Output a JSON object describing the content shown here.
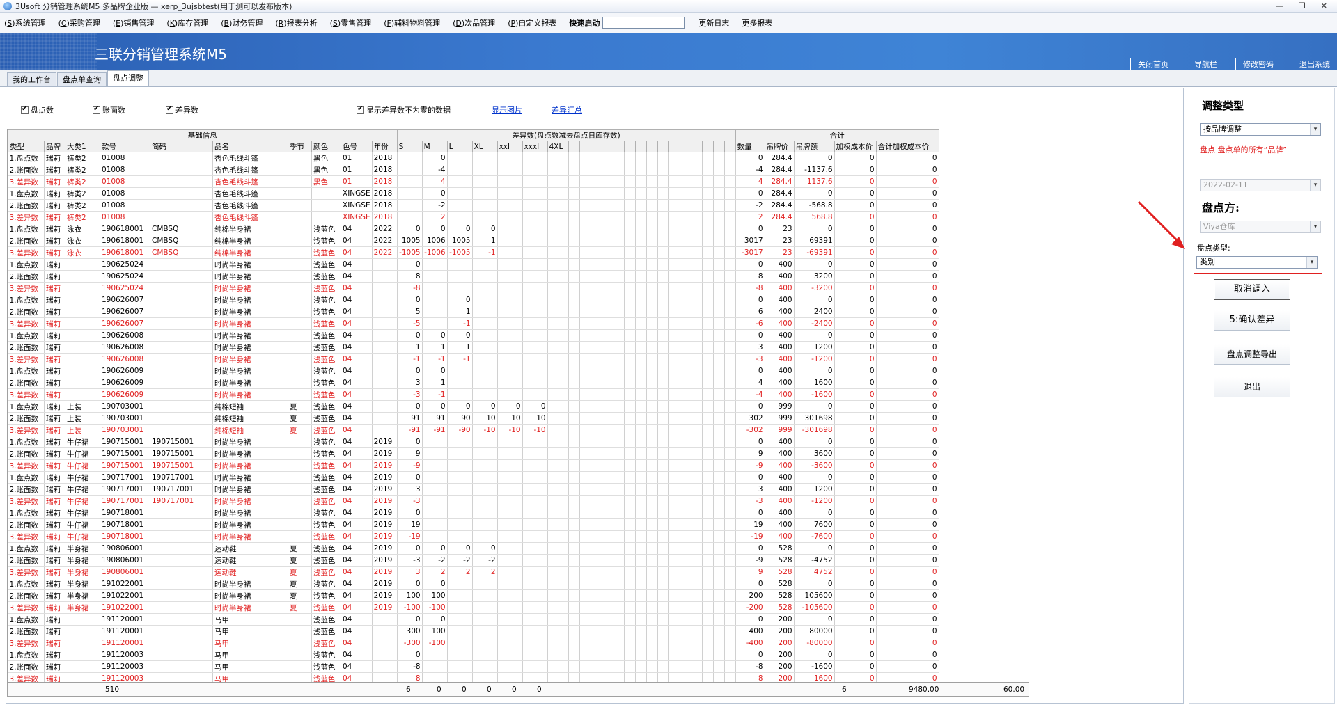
{
  "window": {
    "title": "3Usoft 分销管理系统M5 多品牌企业版 — xerp_3ujsbtest(用于测可以发布版本)"
  },
  "menu": [
    {
      "key": "S",
      "label": "系统管理"
    },
    {
      "key": "C",
      "label": "采购管理"
    },
    {
      "key": "E",
      "label": "销售管理"
    },
    {
      "key": "K",
      "label": "库存管理"
    },
    {
      "key": "B",
      "label": "财务管理"
    },
    {
      "key": "R",
      "label": "报表分析"
    },
    {
      "key": "S",
      "label": "零售管理"
    },
    {
      "key": "F",
      "label": "辅料物料管理"
    },
    {
      "key": "D",
      "label": "次品管理"
    },
    {
      "key": "P",
      "label": "自定义报表"
    }
  ],
  "quickstart_label": "快速启动",
  "menu_extra": [
    "更新日志",
    "更多报表"
  ],
  "banner": {
    "title": "三联分销管理系统M5",
    "links": [
      "关闭首页",
      "导航栏",
      "修改密码",
      "退出系统"
    ]
  },
  "tabs": [
    "我的工作台",
    "盘点单查询",
    "盘点调整"
  ],
  "options": {
    "c1": "盘点数",
    "c2": "账面数",
    "c3": "差异数",
    "c4": "显示差异数不为零的数据",
    "link1": "显示图片",
    "link2": "差异汇总"
  },
  "groups": {
    "basic": "基础信息",
    "diff": "差异数(盘点数减去盘点日库存数)",
    "total": "合计"
  },
  "columns": [
    "类型",
    "品牌",
    "大类1",
    "款号",
    "简码",
    "品名",
    "季节",
    "颜色",
    "色号",
    "年份",
    "S",
    "M",
    "L",
    "XL",
    "xxl",
    "xxxl",
    "4XL",
    "数量",
    "吊牌价",
    "吊牌额",
    "加权成本价",
    "合计加权成本价"
  ],
  "rows": [
    [
      "1.盘点数",
      "瑞莉",
      "裤类2",
      "01008",
      "",
      "杏色毛线斗篷",
      "",
      "黑色",
      "01",
      "2018",
      "",
      "0",
      "",
      "",
      "",
      "",
      "",
      "0",
      "284.4",
      "0",
      "0",
      "0"
    ],
    [
      "2.账面数",
      "瑞莉",
      "裤类2",
      "01008",
      "",
      "杏色毛线斗篷",
      "",
      "黑色",
      "01",
      "2018",
      "",
      "-4",
      "",
      "",
      "",
      "",
      "",
      "-4",
      "284.4",
      "-1137.6",
      "0",
      "0"
    ],
    [
      "3.差异数",
      "瑞莉",
      "裤类2",
      "01008",
      "",
      "杏色毛线斗篷",
      "",
      "黑色",
      "01",
      "2018",
      "",
      "4",
      "",
      "",
      "",
      "",
      "",
      "4",
      "284.4",
      "1137.6",
      "0",
      "0"
    ],
    [
      "1.盘点数",
      "瑞莉",
      "裤类2",
      "01008",
      "",
      "杏色毛线斗篷",
      "",
      "",
      "XINGSE",
      "2018",
      "",
      "0",
      "",
      "",
      "",
      "",
      "",
      "0",
      "284.4",
      "0",
      "0",
      "0"
    ],
    [
      "2.账面数",
      "瑞莉",
      "裤类2",
      "01008",
      "",
      "杏色毛线斗篷",
      "",
      "",
      "XINGSE",
      "2018",
      "",
      "-2",
      "",
      "",
      "",
      "",
      "",
      "-2",
      "284.4",
      "-568.8",
      "0",
      "0"
    ],
    [
      "3.差异数",
      "瑞莉",
      "裤类2",
      "01008",
      "",
      "杏色毛线斗篷",
      "",
      "",
      "XINGSE",
      "2018",
      "",
      "2",
      "",
      "",
      "",
      "",
      "",
      "2",
      "284.4",
      "568.8",
      "0",
      "0"
    ],
    [
      "1.盘点数",
      "瑞莉",
      "泳衣",
      "190618001",
      "CMBSQ",
      "纯棉半身裙",
      "",
      "浅蓝色",
      "04",
      "2022",
      "0",
      "0",
      "0",
      "0",
      "",
      "",
      "",
      "0",
      "23",
      "0",
      "0",
      "0"
    ],
    [
      "2.账面数",
      "瑞莉",
      "泳衣",
      "190618001",
      "CMBSQ",
      "纯棉半身裙",
      "",
      "浅蓝色",
      "04",
      "2022",
      "1005",
      "1006",
      "1005",
      "1",
      "",
      "",
      "",
      "3017",
      "23",
      "69391",
      "0",
      "0"
    ],
    [
      "3.差异数",
      "瑞莉",
      "泳衣",
      "190618001",
      "CMBSQ",
      "纯棉半身裙",
      "",
      "浅蓝色",
      "04",
      "2022",
      "-1005",
      "-1006",
      "-1005",
      "-1",
      "",
      "",
      "",
      "-3017",
      "23",
      "-69391",
      "0",
      "0"
    ],
    [
      "1.盘点数",
      "瑞莉",
      "",
      "190625024",
      "",
      "时尚半身裙",
      "",
      "浅蓝色",
      "04",
      "",
      "0",
      "",
      "",
      "",
      "",
      "",
      "",
      "0",
      "400",
      "0",
      "0",
      "0"
    ],
    [
      "2.账面数",
      "瑞莉",
      "",
      "190625024",
      "",
      "时尚半身裙",
      "",
      "浅蓝色",
      "04",
      "",
      "8",
      "",
      "",
      "",
      "",
      "",
      "",
      "8",
      "400",
      "3200",
      "0",
      "0"
    ],
    [
      "3.差异数",
      "瑞莉",
      "",
      "190625024",
      "",
      "时尚半身裙",
      "",
      "浅蓝色",
      "04",
      "",
      "-8",
      "",
      "",
      "",
      "",
      "",
      "",
      "-8",
      "400",
      "-3200",
      "0",
      "0"
    ],
    [
      "1.盘点数",
      "瑞莉",
      "",
      "190626007",
      "",
      "时尚半身裙",
      "",
      "浅蓝色",
      "04",
      "",
      "0",
      "",
      "0",
      "",
      "",
      "",
      "",
      "0",
      "400",
      "0",
      "0",
      "0"
    ],
    [
      "2.账面数",
      "瑞莉",
      "",
      "190626007",
      "",
      "时尚半身裙",
      "",
      "浅蓝色",
      "04",
      "",
      "5",
      "",
      "1",
      "",
      "",
      "",
      "",
      "6",
      "400",
      "2400",
      "0",
      "0"
    ],
    [
      "3.差异数",
      "瑞莉",
      "",
      "190626007",
      "",
      "时尚半身裙",
      "",
      "浅蓝色",
      "04",
      "",
      "-5",
      "",
      "-1",
      "",
      "",
      "",
      "",
      "-6",
      "400",
      "-2400",
      "0",
      "0"
    ],
    [
      "1.盘点数",
      "瑞莉",
      "",
      "190626008",
      "",
      "时尚半身裙",
      "",
      "浅蓝色",
      "04",
      "",
      "0",
      "0",
      "0",
      "",
      "",
      "",
      "",
      "0",
      "400",
      "0",
      "0",
      "0"
    ],
    [
      "2.账面数",
      "瑞莉",
      "",
      "190626008",
      "",
      "时尚半身裙",
      "",
      "浅蓝色",
      "04",
      "",
      "1",
      "1",
      "1",
      "",
      "",
      "",
      "",
      "3",
      "400",
      "1200",
      "0",
      "0"
    ],
    [
      "3.差异数",
      "瑞莉",
      "",
      "190626008",
      "",
      "时尚半身裙",
      "",
      "浅蓝色",
      "04",
      "",
      "-1",
      "-1",
      "-1",
      "",
      "",
      "",
      "",
      "-3",
      "400",
      "-1200",
      "0",
      "0"
    ],
    [
      "1.盘点数",
      "瑞莉",
      "",
      "190626009",
      "",
      "时尚半身裙",
      "",
      "浅蓝色",
      "04",
      "",
      "0",
      "0",
      "",
      "",
      "",
      "",
      "",
      "0",
      "400",
      "0",
      "0",
      "0"
    ],
    [
      "2.账面数",
      "瑞莉",
      "",
      "190626009",
      "",
      "时尚半身裙",
      "",
      "浅蓝色",
      "04",
      "",
      "3",
      "1",
      "",
      "",
      "",
      "",
      "",
      "4",
      "400",
      "1600",
      "0",
      "0"
    ],
    [
      "3.差异数",
      "瑞莉",
      "",
      "190626009",
      "",
      "时尚半身裙",
      "",
      "浅蓝色",
      "04",
      "",
      "-3",
      "-1",
      "",
      "",
      "",
      "",
      "",
      "-4",
      "400",
      "-1600",
      "0",
      "0"
    ],
    [
      "1.盘点数",
      "瑞莉",
      "上装",
      "190703001",
      "",
      "纯棉短袖",
      "夏",
      "浅蓝色",
      "04",
      "",
      "0",
      "0",
      "0",
      "0",
      "0",
      "0",
      "",
      "0",
      "999",
      "0",
      "0",
      "0"
    ],
    [
      "2.账面数",
      "瑞莉",
      "上装",
      "190703001",
      "",
      "纯棉短袖",
      "夏",
      "浅蓝色",
      "04",
      "",
      "91",
      "91",
      "90",
      "10",
      "10",
      "10",
      "",
      "302",
      "999",
      "301698",
      "0",
      "0"
    ],
    [
      "3.差异数",
      "瑞莉",
      "上装",
      "190703001",
      "",
      "纯棉短袖",
      "夏",
      "浅蓝色",
      "04",
      "",
      "-91",
      "-91",
      "-90",
      "-10",
      "-10",
      "-10",
      "",
      "-302",
      "999",
      "-301698",
      "0",
      "0"
    ],
    [
      "1.盘点数",
      "瑞莉",
      "牛仔裙",
      "190715001",
      "190715001",
      "时尚半身裙",
      "",
      "浅蓝色",
      "04",
      "2019",
      "0",
      "",
      "",
      "",
      "",
      "",
      "",
      "0",
      "400",
      "0",
      "0",
      "0"
    ],
    [
      "2.账面数",
      "瑞莉",
      "牛仔裙",
      "190715001",
      "190715001",
      "时尚半身裙",
      "",
      "浅蓝色",
      "04",
      "2019",
      "9",
      "",
      "",
      "",
      "",
      "",
      "",
      "9",
      "400",
      "3600",
      "0",
      "0"
    ],
    [
      "3.差异数",
      "瑞莉",
      "牛仔裙",
      "190715001",
      "190715001",
      "时尚半身裙",
      "",
      "浅蓝色",
      "04",
      "2019",
      "-9",
      "",
      "",
      "",
      "",
      "",
      "",
      "-9",
      "400",
      "-3600",
      "0",
      "0"
    ],
    [
      "1.盘点数",
      "瑞莉",
      "牛仔裙",
      "190717001",
      "190717001",
      "时尚半身裙",
      "",
      "浅蓝色",
      "04",
      "2019",
      "0",
      "",
      "",
      "",
      "",
      "",
      "",
      "0",
      "400",
      "0",
      "0",
      "0"
    ],
    [
      "2.账面数",
      "瑞莉",
      "牛仔裙",
      "190717001",
      "190717001",
      "时尚半身裙",
      "",
      "浅蓝色",
      "04",
      "2019",
      "3",
      "",
      "",
      "",
      "",
      "",
      "",
      "3",
      "400",
      "1200",
      "0",
      "0"
    ],
    [
      "3.差异数",
      "瑞莉",
      "牛仔裙",
      "190717001",
      "190717001",
      "时尚半身裙",
      "",
      "浅蓝色",
      "04",
      "2019",
      "-3",
      "",
      "",
      "",
      "",
      "",
      "",
      "-3",
      "400",
      "-1200",
      "0",
      "0"
    ],
    [
      "1.盘点数",
      "瑞莉",
      "牛仔裙",
      "190718001",
      "",
      "时尚半身裙",
      "",
      "浅蓝色",
      "04",
      "2019",
      "0",
      "",
      "",
      "",
      "",
      "",
      "",
      "0",
      "400",
      "0",
      "0",
      "0"
    ],
    [
      "2.账面数",
      "瑞莉",
      "牛仔裙",
      "190718001",
      "",
      "时尚半身裙",
      "",
      "浅蓝色",
      "04",
      "2019",
      "19",
      "",
      "",
      "",
      "",
      "",
      "",
      "19",
      "400",
      "7600",
      "0",
      "0"
    ],
    [
      "3.差异数",
      "瑞莉",
      "牛仔裙",
      "190718001",
      "",
      "时尚半身裙",
      "",
      "浅蓝色",
      "04",
      "2019",
      "-19",
      "",
      "",
      "",
      "",
      "",
      "",
      "-19",
      "400",
      "-7600",
      "0",
      "0"
    ],
    [
      "1.盘点数",
      "瑞莉",
      "半身裙",
      "190806001",
      "",
      "运动鞋",
      "夏",
      "浅蓝色",
      "04",
      "2019",
      "0",
      "0",
      "0",
      "0",
      "",
      "",
      "",
      "0",
      "528",
      "0",
      "0",
      "0"
    ],
    [
      "2.账面数",
      "瑞莉",
      "半身裙",
      "190806001",
      "",
      "运动鞋",
      "夏",
      "浅蓝色",
      "04",
      "2019",
      "-3",
      "-2",
      "-2",
      "-2",
      "",
      "",
      "",
      "-9",
      "528",
      "-4752",
      "0",
      "0"
    ],
    [
      "3.差异数",
      "瑞莉",
      "半身裙",
      "190806001",
      "",
      "运动鞋",
      "夏",
      "浅蓝色",
      "04",
      "2019",
      "3",
      "2",
      "2",
      "2",
      "",
      "",
      "",
      "9",
      "528",
      "4752",
      "0",
      "0"
    ],
    [
      "1.盘点数",
      "瑞莉",
      "半身裙",
      "191022001",
      "",
      "时尚半身裙",
      "夏",
      "浅蓝色",
      "04",
      "2019",
      "0",
      "0",
      "",
      "",
      "",
      "",
      "",
      "0",
      "528",
      "0",
      "0",
      "0"
    ],
    [
      "2.账面数",
      "瑞莉",
      "半身裙",
      "191022001",
      "",
      "时尚半身裙",
      "夏",
      "浅蓝色",
      "04",
      "2019",
      "100",
      "100",
      "",
      "",
      "",
      "",
      "",
      "200",
      "528",
      "105600",
      "0",
      "0"
    ],
    [
      "3.差异数",
      "瑞莉",
      "半身裙",
      "191022001",
      "",
      "时尚半身裙",
      "夏",
      "浅蓝色",
      "04",
      "2019",
      "-100",
      "-100",
      "",
      "",
      "",
      "",
      "",
      "-200",
      "528",
      "-105600",
      "0",
      "0"
    ],
    [
      "1.盘点数",
      "瑞莉",
      "",
      "191120001",
      "",
      "马甲",
      "",
      "浅蓝色",
      "04",
      "",
      "0",
      "0",
      "",
      "",
      "",
      "",
      "",
      "0",
      "200",
      "0",
      "0",
      "0"
    ],
    [
      "2.账面数",
      "瑞莉",
      "",
      "191120001",
      "",
      "马甲",
      "",
      "浅蓝色",
      "04",
      "",
      "300",
      "100",
      "",
      "",
      "",
      "",
      "",
      "400",
      "200",
      "80000",
      "0",
      "0"
    ],
    [
      "3.差异数",
      "瑞莉",
      "",
      "191120001",
      "",
      "马甲",
      "",
      "浅蓝色",
      "04",
      "",
      "-300",
      "-100",
      "",
      "",
      "",
      "",
      "",
      "-400",
      "200",
      "-80000",
      "0",
      "0"
    ],
    [
      "1.盘点数",
      "瑞莉",
      "",
      "191120003",
      "",
      "马甲",
      "",
      "浅蓝色",
      "04",
      "",
      "0",
      "",
      "",
      "",
      "",
      "",
      "",
      "0",
      "200",
      "0",
      "0",
      "0"
    ],
    [
      "2.账面数",
      "瑞莉",
      "",
      "191120003",
      "",
      "马甲",
      "",
      "浅蓝色",
      "04",
      "",
      "-8",
      "",
      "",
      "",
      "",
      "",
      "",
      "-8",
      "200",
      "-1600",
      "0",
      "0"
    ],
    [
      "3.差异数",
      "瑞莉",
      "",
      "191120003",
      "",
      "马甲",
      "",
      "浅蓝色",
      "04",
      "",
      "8",
      "",
      "",
      "",
      "",
      "",
      "",
      "8",
      "200",
      "1600",
      "0",
      "0"
    ]
  ],
  "footer": {
    "count": "510",
    "s": "6",
    "zeros": "0",
    "qty": "6",
    "amount": "9480.00",
    "cost": "60.00"
  },
  "right": {
    "adj_title": "调整类型",
    "adj_value": "按品牌调整",
    "note": "盘点 盘点单的所有“品牌”",
    "date": "2022-02-11",
    "side_title": "盘点方:",
    "warehouse": "Viya仓库",
    "type_label": "盘点类型:",
    "type_value": "类别",
    "btn_cancel": "取消调入",
    "btn_confirm": "5:确认差异",
    "btn_export": "盘点调整导出",
    "btn_exit": "退出"
  },
  "colors": {
    "accent": "#3a79cf",
    "diff_red": "#e02020"
  }
}
